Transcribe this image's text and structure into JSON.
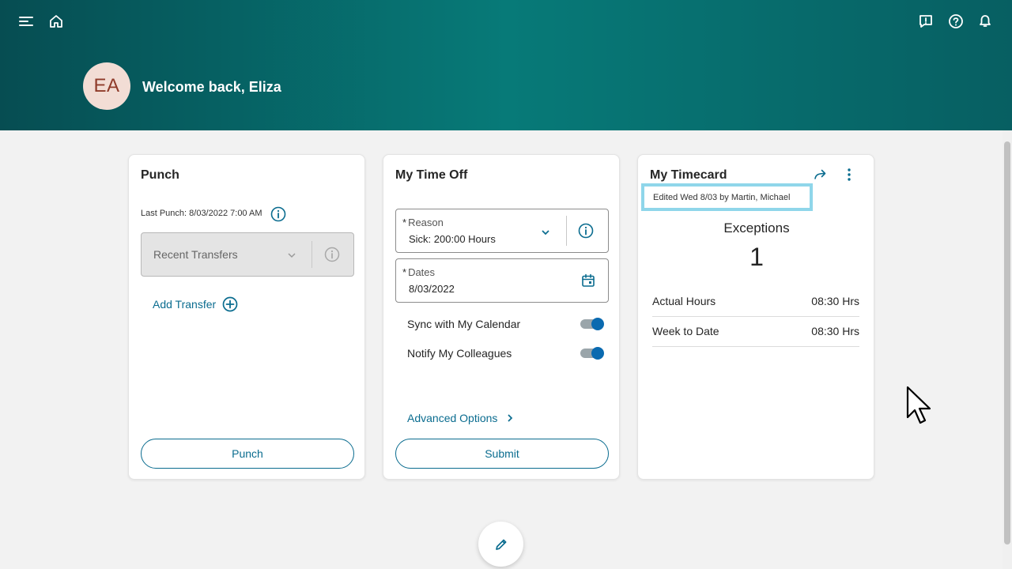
{
  "header": {
    "avatar_initials": "EA",
    "welcome_text": "Welcome back, Eliza"
  },
  "punch": {
    "title": "Punch",
    "last_punch": "Last Punch: 8/03/2022 7:00 AM",
    "transfers_placeholder": "Recent Transfers",
    "add_transfer": "Add Transfer",
    "punch_button": "Punch"
  },
  "time_off": {
    "title": "My Time Off",
    "reason_label": "Reason",
    "reason_value": "Sick: 200:00 Hours",
    "dates_label": "Dates",
    "dates_value": "8/03/2022",
    "required_mark": "*",
    "sync_label": "Sync with My Calendar",
    "sync_on": true,
    "notify_label": "Notify My Colleagues",
    "notify_on": true,
    "advanced_options": "Advanced Options",
    "submit_button": "Submit"
  },
  "timecard": {
    "title": "My Timecard",
    "edited_note": "Edited Wed 8/03 by Martin, Michael",
    "exceptions_label": "Exceptions",
    "exceptions_count": "1",
    "rows": [
      {
        "label": "Actual Hours",
        "value": "08:30 Hrs"
      },
      {
        "label": "Week to Date",
        "value": "08:30 Hrs"
      }
    ]
  },
  "colors": {
    "header_teal": "#077a78",
    "accent_blue": "#0a6c8f",
    "toggle_blue": "#0a6ab0",
    "highlight_cyan": "#8fd6ea"
  },
  "icons": {
    "menu": "menu-icon",
    "home": "home-icon",
    "feedback": "feedback-icon",
    "help": "help-icon",
    "notifications": "bell-icon",
    "edit": "pencil-icon"
  }
}
